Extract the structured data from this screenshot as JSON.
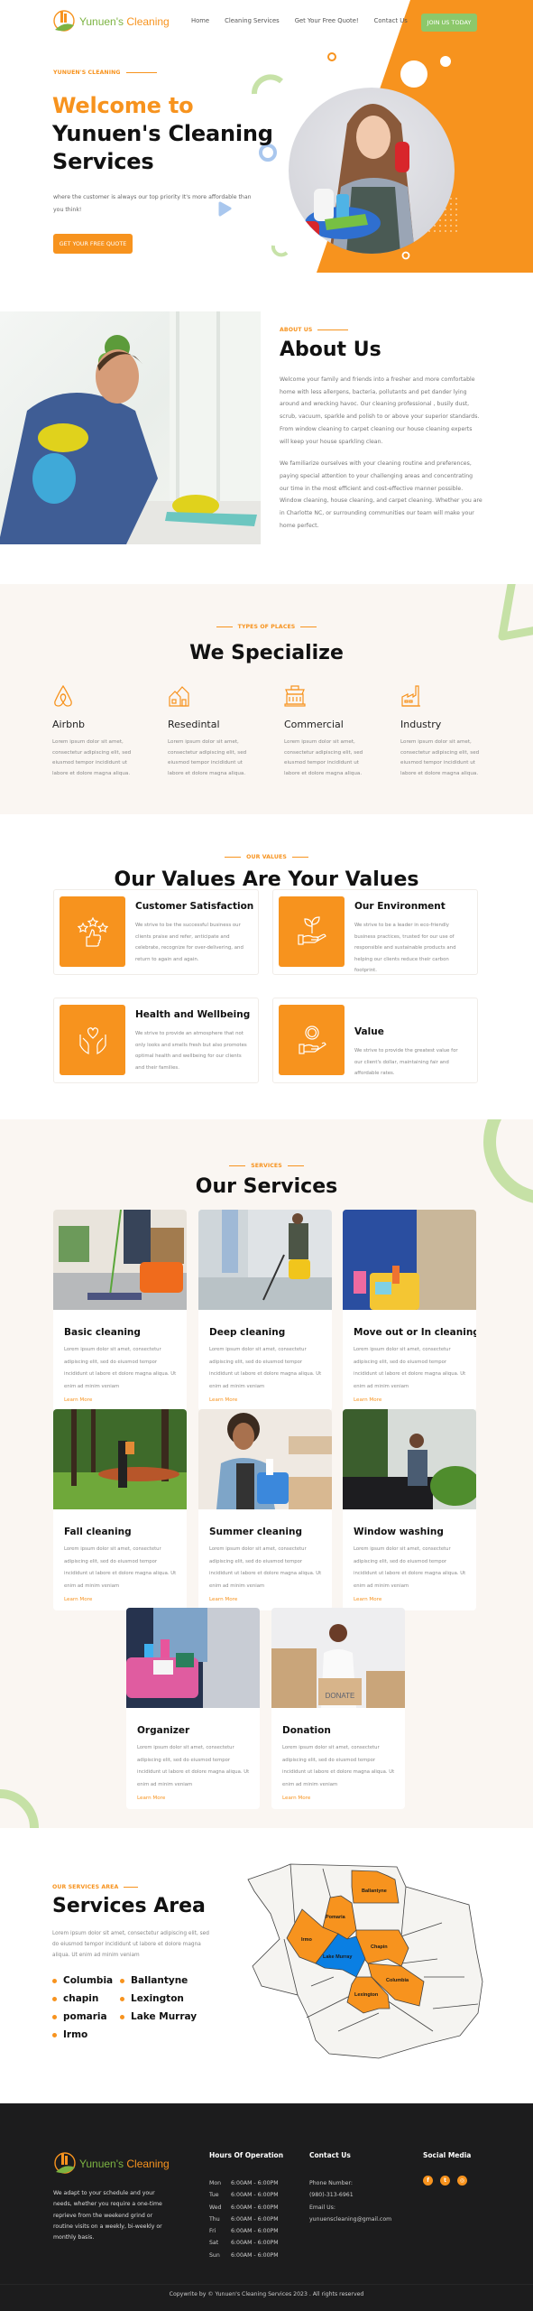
{
  "brand": {
    "name_part1": "Yunuen's",
    "name_part2": "Cleaning"
  },
  "colors": {
    "accent": "#f7931e",
    "green": "#8cc86b",
    "bg_alt": "#faf6f2",
    "footer_bg": "#1c1c1d",
    "map_highlight": "#0a7fe3"
  },
  "nav": {
    "items": [
      {
        "label": "Home"
      },
      {
        "label": "Cleaning Services"
      },
      {
        "label": "Get Your Free Quote!"
      },
      {
        "label": "Contact Us"
      }
    ],
    "cta": "JOIN US TODAY"
  },
  "hero": {
    "kicker": "YUNUEN'S CLEANING",
    "title_line1": "Welcome to",
    "title_line2": "Yunuen's Cleaning",
    "title_line3": "Services",
    "description": "where the customer is always our top priority It's more affordable than you think!",
    "cta": "GET YOUR FREE QUOTE"
  },
  "about": {
    "kicker": "ABOUT US",
    "title": "About Us",
    "paragraphs": [
      "Welcome your family and friends into a fresher and more comfortable home with less allergens, bacteria, pollutants and pet dander lying around and wrecking havoc. Our cleaning professional , busily dust, scrub, vacuum, sparkle and polish to or above your superior standards. From window cleaning to carpet cleaning our house cleaning experts will keep your house sparkling clean.",
      "We familiarize ourselves with your cleaning routine and preferences, paying special attention to your challenging areas and concentrating our time in the most efficient and cost-effective manner possible. Window cleaning, house cleaning, and carpet cleaning. Whether you are in Charlotte NC, or surrounding communities our team will make your home perfect."
    ]
  },
  "specialize": {
    "kicker": "TYPES OF PLACES",
    "title": "We Specialize",
    "items": [
      {
        "icon": "airbnb-icon",
        "title": "Airbnb",
        "text": "Lorem ipsum dolor sit amet, consectetur adipiscing elit, sed eiusmod tempor incididunt ut labore et dolore magna aliqua."
      },
      {
        "icon": "houses-icon",
        "title": "Resedintal",
        "text": "Lorem ipsum dolor sit amet, consectetur adipiscing elit, sed eiusmod tempor incididunt ut labore et dolore magna aliqua."
      },
      {
        "icon": "storefront-icon",
        "title": "Commercial",
        "text": "Lorem ipsum dolor sit amet, consectetur adipiscing elit, sed eiusmod tempor incididunt ut labore et dolore magna aliqua."
      },
      {
        "icon": "factory-icon",
        "title": "Industry",
        "text": "Lorem ipsum dolor sit amet, consectetur adipiscing elit, sed eiusmod tempor incididunt ut labore et dolore magna aliqua."
      }
    ]
  },
  "values": {
    "kicker": "OUR VALUES",
    "title": "Our Values Are Your Values",
    "items": [
      {
        "icon": "stars-thumbs-up-icon",
        "title": "Customer Satisfaction",
        "text": "We strive to be the successful business our clients praise and refer, anticipate and celebrate, recognize for over-delivering, and return to again and again."
      },
      {
        "icon": "plant-in-hand-icon",
        "title": "Our Environment",
        "text": "We strive to be a leader in eco-friendly business practices, trusted for our use of responsible and sustainable products and helping our clients reduce their carbon footprint."
      },
      {
        "icon": "heart-hands-icon",
        "title": "Health and Wellbeing",
        "text": "We strive to provide an atmosphere that not only looks and smells fresh but also promotes optimal health and wellbeing for our clients and their families."
      },
      {
        "icon": "coin-in-hand-icon",
        "title": "Value",
        "text": "We strive to provide the greatest value for our client's dollar, maintaining fair and affordable rates."
      }
    ]
  },
  "services": {
    "kicker": "SERVICES",
    "title": "Our Services",
    "learn_more": "Learn More",
    "items": [
      {
        "title": "Basic cleaning",
        "text": "Lorem ipsum dolor sit amet, consectetur adipiscing elit, sed do eiusmod tempor incididunt ut labore et dolore magna aliqua. Ut enim ad minim veniam"
      },
      {
        "title": "Deep cleaning",
        "text": "Lorem ipsum dolor sit amet, consectetur adipiscing elit, sed do eiusmod tempor incididunt ut labore et dolore magna aliqua. Ut enim ad minim veniam"
      },
      {
        "title": "Move out or In cleaning",
        "text": "Lorem ipsum dolor sit amet, consectetur adipiscing elit, sed do eiusmod tempor incididunt ut labore et dolore magna aliqua. Ut enim ad minim veniam"
      },
      {
        "title": "Fall cleaning",
        "text": "Lorem ipsum dolor sit amet, consectetur adipiscing elit, sed do eiusmod tempor incididunt ut labore et dolore magna aliqua. Ut enim ad minim veniam"
      },
      {
        "title": "Summer cleaning",
        "text": "Lorem ipsum dolor sit amet, consectetur adipiscing elit, sed do eiusmod tempor incididunt ut labore et dolore magna aliqua. Ut enim ad minim veniam"
      },
      {
        "title": "Window washing",
        "text": "Lorem ipsum dolor sit amet, consectetur adipiscing elit, sed do eiusmod tempor incididunt ut labore et dolore magna aliqua. Ut enim ad minim veniam"
      },
      {
        "title": "Organizer",
        "text": "Lorem ipsum dolor sit amet, consectetur adipiscing elit, sed do eiusmod tempor incididunt ut labore et dolore magna aliqua. Ut enim ad minim veniam"
      },
      {
        "title": "Donation",
        "text": "Lorem ipsum dolor sit amet, consectetur adipiscing elit, sed do eiusmod tempor incididunt ut labore et dolore magna aliqua. Ut enim ad minim veniam",
        "image_label": "DONATE"
      }
    ]
  },
  "area": {
    "kicker": "OUR SERVICES AREA",
    "title": "Services Area",
    "description": "Lorem ipsum dolor sit amet, consectetur adipiscing elit, sed do eiusmod tempor incididunt ut labore et dolore magna aliqua. Ut enim ad minim veniam",
    "list": [
      "Columbia",
      "Ballantyne",
      "chapin",
      "Lexington",
      "pomaria",
      "Lake Murray",
      "Irmo"
    ],
    "map_labels": {
      "ballantyne": "Ballantyne",
      "pomaria": "Pomaria",
      "irmo": "Irmo",
      "chapin": "Chapin",
      "lake_murray": "Lake Murray",
      "columbia": "Columbia",
      "lexington": "Lexington"
    }
  },
  "footer": {
    "about": "We adapt to your schedule and your needs, whether you require a one-time reprieve from the weekend grind or routine visits on a weekly, bi-weekly or monthly basis.",
    "hours_title": "Hours Of Operation",
    "hours": [
      {
        "day": "Mon",
        "time": "6:00AM - 6:00PM"
      },
      {
        "day": "Tue",
        "time": "6:00AM - 6:00PM"
      },
      {
        "day": "Wed",
        "time": "6:00AM - 6:00PM"
      },
      {
        "day": "Thu",
        "time": "6:00AM - 6:00PM"
      },
      {
        "day": "Fri",
        "time": "6:00AM - 6:00PM"
      },
      {
        "day": "Sat",
        "time": "6:00AM - 6:00PM"
      },
      {
        "day": "Sun",
        "time": "6:00AM - 6:00PM"
      }
    ],
    "contact_title": "Contact Us",
    "phone_label": "Phone Number:",
    "phone": "(980)-313-6961",
    "email_label": "Email Us:",
    "email": "yunuenscleaning@gmail.com",
    "social_title": "Social Media",
    "social": [
      {
        "icon": "facebook-icon",
        "glyph": "f"
      },
      {
        "icon": "twitter-icon",
        "glyph": "t"
      },
      {
        "icon": "instagram-icon",
        "glyph": "◎"
      }
    ],
    "copyright": "Copywrite by © Yunuen's Cleaning Services 2023 . All rights reserved"
  }
}
